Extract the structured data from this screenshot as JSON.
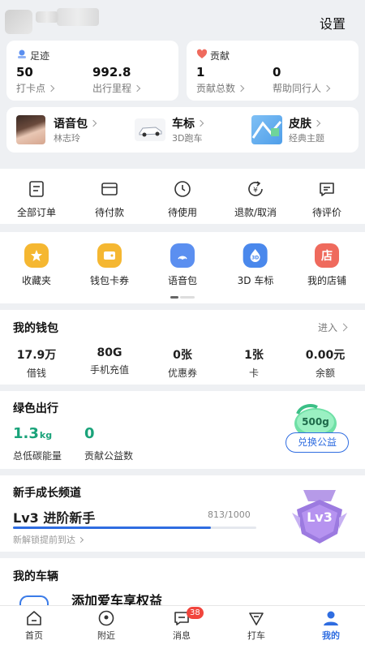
{
  "header": {
    "settings_label": "设置"
  },
  "footprint": {
    "title": "足迹",
    "stats": [
      {
        "value": "50",
        "label": "打卡点"
      },
      {
        "value": "992.8",
        "label": "出行里程"
      }
    ]
  },
  "contribution": {
    "title": "贡献",
    "stats": [
      {
        "value": "1",
        "label": "贡献总数"
      },
      {
        "value": "0",
        "label": "帮助同行人"
      }
    ]
  },
  "features": [
    {
      "title": "语音包",
      "sub": "林志玲"
    },
    {
      "title": "车标",
      "sub": "3D跑车"
    },
    {
      "title": "皮肤",
      "sub": "经典主题"
    }
  ],
  "orders": [
    {
      "label": "全部订单",
      "icon": "document-icon"
    },
    {
      "label": "待付款",
      "icon": "wallet-icon"
    },
    {
      "label": "待使用",
      "icon": "clock-icon"
    },
    {
      "label": "退款/取消",
      "icon": "refund-icon"
    },
    {
      "label": "待评价",
      "icon": "comment-icon"
    }
  ],
  "shortcuts": [
    {
      "label": "收藏夹",
      "icon": "star-icon",
      "color": "#f5b731"
    },
    {
      "label": "钱包卡券",
      "icon": "wallet-icon",
      "color": "#f5b731"
    },
    {
      "label": "语音包",
      "icon": "voice-icon",
      "color": "#5b8ff0"
    },
    {
      "label": "3D 车标",
      "icon": "car3d-icon",
      "color": "#4a88ec"
    },
    {
      "label": "我的店铺",
      "icon": "shop-icon",
      "color": "#ef6a5d",
      "glyph": "店"
    }
  ],
  "wallet": {
    "title": "我的钱包",
    "enter_label": "进入",
    "items": [
      {
        "value": "17.9万",
        "label": "借钱"
      },
      {
        "value": "80G",
        "label": "手机充值"
      },
      {
        "value": "0张",
        "label": "优惠券"
      },
      {
        "value": "1张",
        "label": "卡"
      },
      {
        "value": "0.00元",
        "label": "余额"
      }
    ]
  },
  "green": {
    "title": "绿色出行",
    "carbon_value": "1.3",
    "carbon_unit": "kg",
    "carbon_label": "总低碳能量",
    "donate_value": "0",
    "donate_label": "贡献公益数",
    "badge": "500g",
    "exchange_label": "兑换公益"
  },
  "growth": {
    "title": "新手成长频道",
    "level_label": "Lv3 进阶新手",
    "progress_text": "813",
    "progress_total": "/1000",
    "progress": 0.813,
    "unlock_label": "新解锁提前到达",
    "medal": "Lv3"
  },
  "vehicle": {
    "title": "我的车辆",
    "add_label": "添加爱车享权益"
  },
  "tabs": [
    {
      "label": "首页",
      "icon": "home-icon"
    },
    {
      "label": "附近",
      "icon": "location-icon"
    },
    {
      "label": "消息",
      "icon": "message-icon",
      "badge": "38"
    },
    {
      "label": "打车",
      "icon": "taxi-icon"
    },
    {
      "label": "我的",
      "icon": "profile-icon",
      "active": true
    }
  ],
  "colors": {
    "accent": "#2f6de1",
    "green": "#1aa37a",
    "badge_red": "#f1453d"
  }
}
